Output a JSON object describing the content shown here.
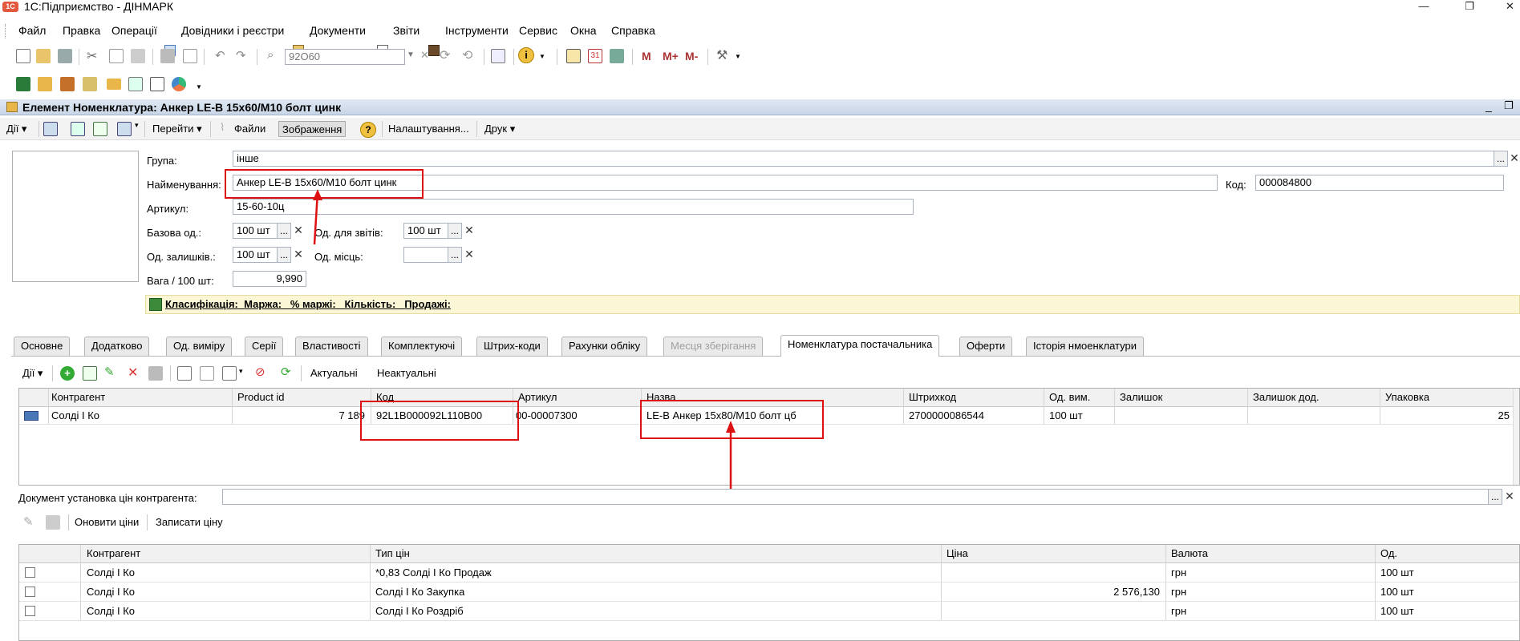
{
  "app": {
    "title": "1С:Підприємство - ДІНМАРК",
    "logo_text": "1С"
  },
  "menu": [
    "Файл",
    "Правка",
    "Операції",
    "Довідники і реєстри",
    "Документи",
    "Звіти",
    "Інструменти",
    "Сервис",
    "Окна",
    "Справка"
  ],
  "toolbar": {
    "search_value": "92O60",
    "mem_buttons": [
      "M",
      "M+",
      "M-"
    ]
  },
  "form": {
    "title": "Елемент Номенклатура: Анкер LE-B 15x60/M10 болт цинк",
    "buttons": [
      "Дії",
      "Перейти",
      "Файли",
      "Зображення",
      "Налаштування...",
      "Друк"
    ],
    "fields": {
      "group_label": "Група:",
      "group_value": "інше",
      "name_label": "Найменування:",
      "name_value": "Анкер LE-B 15x60/M10 болт цинк",
      "code_label": "Код:",
      "code_value": "000084800",
      "article_label": "Артикул:",
      "article_value": "15-60-10ц",
      "base_unit_label": "Базова од.:",
      "base_unit_value": "100 шт",
      "report_unit_label": "Од. для звітів:",
      "report_unit_value": "100 шт",
      "stock_unit_label": "Од. залишків.:",
      "stock_unit_value": "100 шт",
      "place_unit_label": "Од. місць:",
      "place_unit_value": "",
      "weight_label": "Вага / 100 шт:",
      "weight_value": "9,990"
    },
    "classification": [
      "Класифікація:",
      "Маржа:",
      "% маржі:",
      "Кількість:",
      "Продажі:"
    ]
  },
  "tabs": [
    "Основне",
    "Додатково",
    "Од. виміру",
    "Серії",
    "Властивості",
    "Комплектуючі",
    "Штрих-коди",
    "Рахунки обліку",
    "Месця зберігання",
    "Номенклатура постачальника",
    "Оферти",
    "Історія нмоенклатури"
  ],
  "supplier_toolbar": {
    "actions_label": "Дії",
    "actual": "Актуальні",
    "not_actual": "Неактуальні"
  },
  "supplier_grid": {
    "columns": [
      "Контрагент",
      "Product id",
      "Код",
      "Артикул",
      "Назва",
      "Штрихкод",
      "Од. вим.",
      "Залишок",
      "Залишок дод.",
      "Упаковка"
    ],
    "rows": [
      {
        "contractor": "Солді І Ко",
        "product_id": "7 189",
        "code": "92L1B000092L110B00",
        "article": "00-00007300",
        "name": "LE-B Анкер 15x80/M10 болт цб",
        "barcode": "2700000086544",
        "unit": "100 шт",
        "rest": "",
        "rest_add": "",
        "pack": "25"
      }
    ]
  },
  "price_doc_label": "Документ установка цін контрагента:",
  "price_toolbar": {
    "update": "Оновити ціни",
    "write": "Записати ціну"
  },
  "price_grid": {
    "columns": [
      "Контрагент",
      "Тип цін",
      "Ціна",
      "Валюта",
      "Од."
    ],
    "rows": [
      {
        "contractor": "Солді І Ко",
        "price_type": "*0,83 Солді І Ко Продаж",
        "price": "",
        "currency": "грн",
        "unit": "100 шт"
      },
      {
        "contractor": "Солді І Ко",
        "price_type": "Солді І Ко Закупка",
        "price": "2 576,130",
        "currency": "грн",
        "unit": "100 шт"
      },
      {
        "contractor": "Солді І Ко",
        "price_type": "Солді І Ко Роздріб",
        "price": "",
        "currency": "грн",
        "unit": "100 шт"
      }
    ]
  }
}
